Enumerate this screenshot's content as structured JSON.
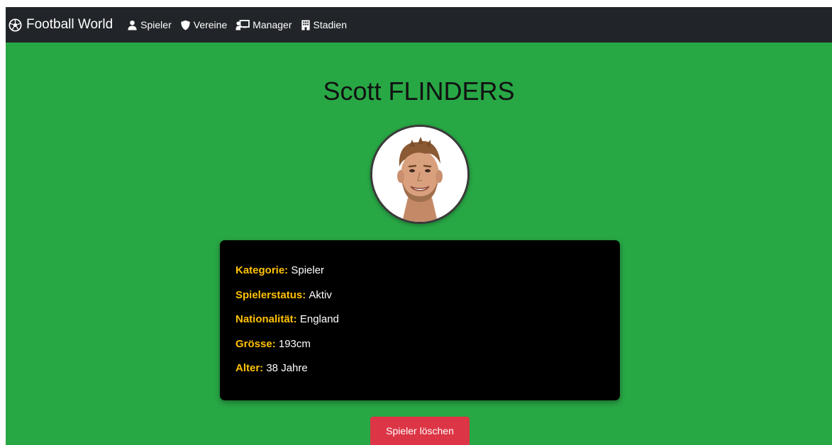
{
  "navbar": {
    "brand": "Football World",
    "brand_icon": "soccer-ball-icon",
    "items": [
      {
        "label": "Spieler",
        "icon": "person-icon"
      },
      {
        "label": "Vereine",
        "icon": "shield-icon"
      },
      {
        "label": "Manager",
        "icon": "chalkboard-teacher-icon"
      },
      {
        "label": "Stadien",
        "icon": "building-icon"
      }
    ]
  },
  "player": {
    "name": "Scott FLINDERS",
    "photo_icon": "player-photo"
  },
  "details": [
    {
      "label": "Kategorie:",
      "value": "Spieler"
    },
    {
      "label": "Spielerstatus:",
      "value": "Aktiv"
    },
    {
      "label": "Nationalität:",
      "value": "England"
    },
    {
      "label": "Grösse:",
      "value": "193cm"
    },
    {
      "label": "Alter:",
      "value": "38 Jahre"
    }
  ],
  "actions": {
    "delete_label": "Spieler löschen"
  },
  "colors": {
    "page_background": "#28a745",
    "navbar": "#212529",
    "card": "#000000",
    "label": "#ffc107",
    "delete_button": "#dc3545"
  }
}
